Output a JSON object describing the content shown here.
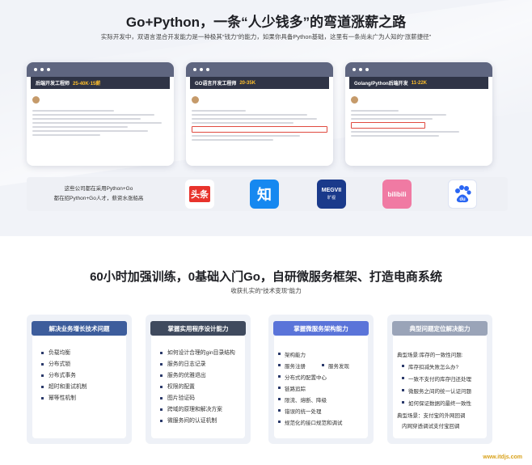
{
  "header": {
    "title": "Go+Python，一条“人少钱多”的弯道涨薪之路",
    "subtitle": "实际开发中，双语言混合开发能力是一种极其“钱力”的能力，如果你具备Python基础，这里有一条尚未广为人知的“涨薪捷径”"
  },
  "job_screens": [
    {
      "title": "后端开发工程师",
      "salary": "25-40K·15薪"
    },
    {
      "title": "GO语言开发工程师",
      "salary": "20-35K"
    },
    {
      "title": "Golang/Python后端开发",
      "salary": "11-22K"
    }
  ],
  "companies": {
    "text_line1": "这些公司都在采用Python+Go",
    "text_line2": "都在招Python+Go人才，薪资水涨船高",
    "logos": [
      {
        "label": "头条",
        "color": "#e8332c"
      },
      {
        "label": "知",
        "color": "#1688f0"
      },
      {
        "label": "MEGVII",
        "sublabel": "旷视",
        "color": "#1a3a8b"
      },
      {
        "label": "bilibili",
        "color": "#f07aa3"
      },
      {
        "label": "du",
        "color": "#2a66f3"
      }
    ]
  },
  "section2": {
    "title": "60小时加强训练，0基础入门Go，自研微服务框架、打造电商系统",
    "subtitle": "收获扎实的“技术变现”能力"
  },
  "cards": [
    {
      "heading": "解决业务增长技术问题",
      "color": "#3d5d9c",
      "items": [
        "负载均衡",
        "分布式锁",
        "分布式事务",
        "超时和重试机制",
        "幂等性机制"
      ]
    },
    {
      "heading": "掌握实用程序设计能力",
      "color": "#3f4a5e",
      "items": [
        "如何设计合理的gin目录结构",
        "服务的日志记录",
        "服务的优雅退出",
        "权限的配置",
        "图片验证码",
        "跨域的原理和解决方案",
        "微服务间的认证机制"
      ]
    },
    {
      "heading": "掌握微服务架构能力",
      "color": "#5a74d9",
      "items": [
        "架构能力",
        "服务注册",
        "服务发现",
        "分布式的配置中心",
        "链路追踪",
        "限流、熔断、降级",
        "错误的统一处理",
        "规范化的接口规范和调试"
      ]
    },
    {
      "heading": "典型问题定位解决能力",
      "color": "#9aa4b8",
      "intro": "典型场景:库存的一致性问题:",
      "items": [
        "库存扣减失败怎么办?",
        "一致不支付的库存归还处理",
        "微服务之间的统一认证问题",
        "如何保证数据的最终一致性"
      ],
      "outro1": "典型场景：支付宝的外网回调",
      "outro2": "内网穿透调试支付宝回调"
    }
  ],
  "footer": {
    "watermark": "www.itdjs.com"
  }
}
